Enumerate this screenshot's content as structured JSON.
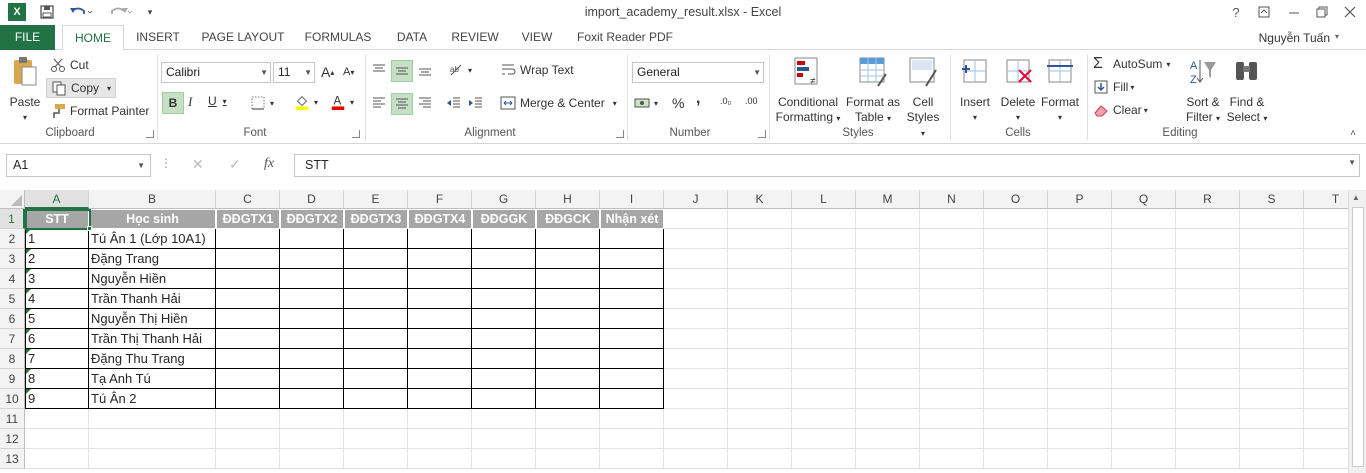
{
  "window": {
    "title": "import_academy_result.xlsx - Excel"
  },
  "quick_access": {
    "excel_icon": "X",
    "save_icon": "save-icon",
    "undo_icon": "undo-icon",
    "redo_icon": "redo-icon",
    "customize_icon": "customize-icon"
  },
  "tabs": [
    {
      "label": "FILE"
    },
    {
      "label": "HOME"
    },
    {
      "label": "INSERT"
    },
    {
      "label": "PAGE LAYOUT"
    },
    {
      "label": "FORMULAS"
    },
    {
      "label": "DATA"
    },
    {
      "label": "REVIEW"
    },
    {
      "label": "VIEW"
    },
    {
      "label": "Foxit Reader PDF"
    }
  ],
  "user": {
    "name": "Nguyễn Tuấn"
  },
  "ribbon": {
    "clipboard": {
      "paste": "Paste",
      "cut": "Cut",
      "copy": "Copy",
      "format_painter": "Format Painter",
      "label": "Clipboard"
    },
    "font": {
      "name": "Calibri",
      "size": "11",
      "label": "Font",
      "bold": "B",
      "italic": "I",
      "underline": "U",
      "grow": "A",
      "shrink": "A"
    },
    "alignment": {
      "wrap": "Wrap Text",
      "merge": "Merge & Center",
      "label": "Alignment"
    },
    "number": {
      "format": "General",
      "percent": "%",
      "comma": ",",
      "inc": ".0₀",
      "dec": ".00",
      "label": "Number"
    },
    "styles": {
      "conditional": [
        "Conditional",
        "Formatting"
      ],
      "format_table": [
        "Format as",
        "Table"
      ],
      "cell_styles": [
        "Cell",
        "Styles"
      ],
      "label": "Styles"
    },
    "cells": {
      "insert": "Insert",
      "delete": "Delete",
      "format": "Format",
      "label": "Cells"
    },
    "editing": {
      "autosum": "AutoSum",
      "fill": "Fill",
      "clear": "Clear",
      "sort": [
        "Sort &",
        "Filter"
      ],
      "find": [
        "Find &",
        "Select"
      ],
      "label": "Editing"
    }
  },
  "formula_bar": {
    "name_box": "A1",
    "fx": "fx",
    "cancel": "✕",
    "enter": "✓",
    "value": "STT"
  },
  "sheet": {
    "columns": [
      "A",
      "B",
      "C",
      "D",
      "E",
      "F",
      "G",
      "H",
      "I",
      "J",
      "K",
      "L",
      "M",
      "N",
      "O",
      "P",
      "Q",
      "R",
      "S",
      "T"
    ],
    "rows": [
      "1",
      "2",
      "3",
      "4",
      "5",
      "6",
      "7",
      "8",
      "9",
      "10",
      "11",
      "12",
      "13"
    ],
    "header_row": [
      "STT",
      "Học sinh",
      "ĐĐGTX1",
      "ĐĐGTX2",
      "ĐĐGTX3",
      "ĐĐGTX4",
      "ĐĐGGK",
      "ĐĐGCK",
      "Nhận xét"
    ],
    "data": [
      [
        "1",
        "Tú Ân 1 (Lớp 10A1)"
      ],
      [
        "2",
        "Đặng Trang"
      ],
      [
        "3",
        "Nguyễn Hiền"
      ],
      [
        "4",
        "Trần Thanh Hải"
      ],
      [
        "5",
        "Nguyễn Thị Hiền"
      ],
      [
        "6",
        "Trần Thị Thanh Hải"
      ],
      [
        "7",
        "Đặng Thu Trang"
      ],
      [
        "8",
        "Tạ Anh Tú"
      ],
      [
        "9",
        "Tú Ân 2"
      ]
    ]
  }
}
